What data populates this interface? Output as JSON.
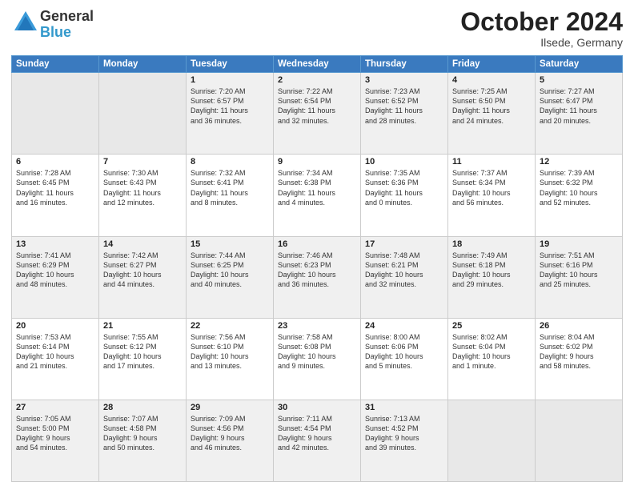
{
  "header": {
    "logo_general": "General",
    "logo_blue": "Blue",
    "month_title": "October 2024",
    "location": "Ilsede, Germany"
  },
  "weekdays": [
    "Sunday",
    "Monday",
    "Tuesday",
    "Wednesday",
    "Thursday",
    "Friday",
    "Saturday"
  ],
  "weeks": [
    [
      {
        "day": "",
        "info": ""
      },
      {
        "day": "",
        "info": ""
      },
      {
        "day": "1",
        "info": "Sunrise: 7:20 AM\nSunset: 6:57 PM\nDaylight: 11 hours\nand 36 minutes."
      },
      {
        "day": "2",
        "info": "Sunrise: 7:22 AM\nSunset: 6:54 PM\nDaylight: 11 hours\nand 32 minutes."
      },
      {
        "day": "3",
        "info": "Sunrise: 7:23 AM\nSunset: 6:52 PM\nDaylight: 11 hours\nand 28 minutes."
      },
      {
        "day": "4",
        "info": "Sunrise: 7:25 AM\nSunset: 6:50 PM\nDaylight: 11 hours\nand 24 minutes."
      },
      {
        "day": "5",
        "info": "Sunrise: 7:27 AM\nSunset: 6:47 PM\nDaylight: 11 hours\nand 20 minutes."
      }
    ],
    [
      {
        "day": "6",
        "info": "Sunrise: 7:28 AM\nSunset: 6:45 PM\nDaylight: 11 hours\nand 16 minutes."
      },
      {
        "day": "7",
        "info": "Sunrise: 7:30 AM\nSunset: 6:43 PM\nDaylight: 11 hours\nand 12 minutes."
      },
      {
        "day": "8",
        "info": "Sunrise: 7:32 AM\nSunset: 6:41 PM\nDaylight: 11 hours\nand 8 minutes."
      },
      {
        "day": "9",
        "info": "Sunrise: 7:34 AM\nSunset: 6:38 PM\nDaylight: 11 hours\nand 4 minutes."
      },
      {
        "day": "10",
        "info": "Sunrise: 7:35 AM\nSunset: 6:36 PM\nDaylight: 11 hours\nand 0 minutes."
      },
      {
        "day": "11",
        "info": "Sunrise: 7:37 AM\nSunset: 6:34 PM\nDaylight: 10 hours\nand 56 minutes."
      },
      {
        "day": "12",
        "info": "Sunrise: 7:39 AM\nSunset: 6:32 PM\nDaylight: 10 hours\nand 52 minutes."
      }
    ],
    [
      {
        "day": "13",
        "info": "Sunrise: 7:41 AM\nSunset: 6:29 PM\nDaylight: 10 hours\nand 48 minutes."
      },
      {
        "day": "14",
        "info": "Sunrise: 7:42 AM\nSunset: 6:27 PM\nDaylight: 10 hours\nand 44 minutes."
      },
      {
        "day": "15",
        "info": "Sunrise: 7:44 AM\nSunset: 6:25 PM\nDaylight: 10 hours\nand 40 minutes."
      },
      {
        "day": "16",
        "info": "Sunrise: 7:46 AM\nSunset: 6:23 PM\nDaylight: 10 hours\nand 36 minutes."
      },
      {
        "day": "17",
        "info": "Sunrise: 7:48 AM\nSunset: 6:21 PM\nDaylight: 10 hours\nand 32 minutes."
      },
      {
        "day": "18",
        "info": "Sunrise: 7:49 AM\nSunset: 6:18 PM\nDaylight: 10 hours\nand 29 minutes."
      },
      {
        "day": "19",
        "info": "Sunrise: 7:51 AM\nSunset: 6:16 PM\nDaylight: 10 hours\nand 25 minutes."
      }
    ],
    [
      {
        "day": "20",
        "info": "Sunrise: 7:53 AM\nSunset: 6:14 PM\nDaylight: 10 hours\nand 21 minutes."
      },
      {
        "day": "21",
        "info": "Sunrise: 7:55 AM\nSunset: 6:12 PM\nDaylight: 10 hours\nand 17 minutes."
      },
      {
        "day": "22",
        "info": "Sunrise: 7:56 AM\nSunset: 6:10 PM\nDaylight: 10 hours\nand 13 minutes."
      },
      {
        "day": "23",
        "info": "Sunrise: 7:58 AM\nSunset: 6:08 PM\nDaylight: 10 hours\nand 9 minutes."
      },
      {
        "day": "24",
        "info": "Sunrise: 8:00 AM\nSunset: 6:06 PM\nDaylight: 10 hours\nand 5 minutes."
      },
      {
        "day": "25",
        "info": "Sunrise: 8:02 AM\nSunset: 6:04 PM\nDaylight: 10 hours\nand 1 minute."
      },
      {
        "day": "26",
        "info": "Sunrise: 8:04 AM\nSunset: 6:02 PM\nDaylight: 9 hours\nand 58 minutes."
      }
    ],
    [
      {
        "day": "27",
        "info": "Sunrise: 7:05 AM\nSunset: 5:00 PM\nDaylight: 9 hours\nand 54 minutes."
      },
      {
        "day": "28",
        "info": "Sunrise: 7:07 AM\nSunset: 4:58 PM\nDaylight: 9 hours\nand 50 minutes."
      },
      {
        "day": "29",
        "info": "Sunrise: 7:09 AM\nSunset: 4:56 PM\nDaylight: 9 hours\nand 46 minutes."
      },
      {
        "day": "30",
        "info": "Sunrise: 7:11 AM\nSunset: 4:54 PM\nDaylight: 9 hours\nand 42 minutes."
      },
      {
        "day": "31",
        "info": "Sunrise: 7:13 AM\nSunset: 4:52 PM\nDaylight: 9 hours\nand 39 minutes."
      },
      {
        "day": "",
        "info": ""
      },
      {
        "day": "",
        "info": ""
      }
    ]
  ]
}
